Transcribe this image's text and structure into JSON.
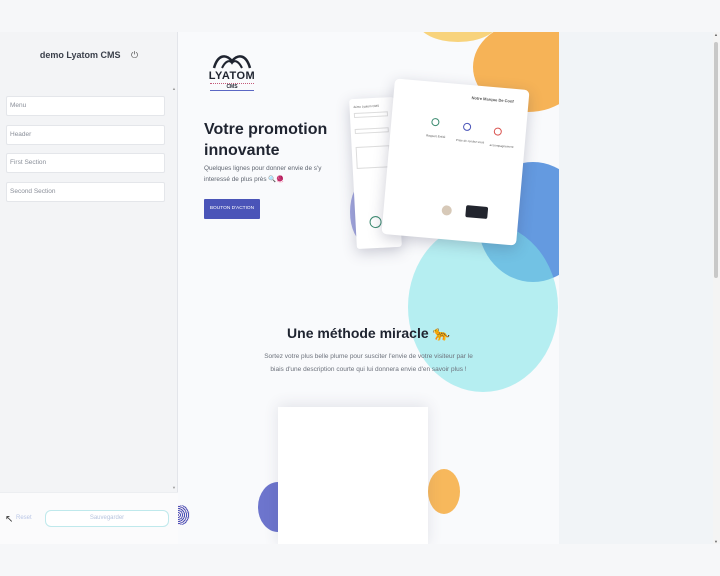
{
  "sidebar": {
    "title": "demo Lyatom CMS",
    "power_icon": "power-icon",
    "items": [
      {
        "label": "Menu"
      },
      {
        "label": "Header"
      },
      {
        "label": "First Section"
      },
      {
        "label": "Second Section"
      }
    ],
    "reset_label": "Reset",
    "save_label": "Sauvegarder"
  },
  "preview": {
    "logo": {
      "name": "LYATOM",
      "sub": "CMS"
    },
    "hero": {
      "title": "Votre promotion innovante",
      "text": "Quelques lignes pour donner envie de s'y interessé de plus près 🔍🧶",
      "button": "BOUTON D'ACTION"
    },
    "mockup": {
      "heading": "Notre Marque De Conf",
      "sidebar_title": "démo Lyatom CMS",
      "col1": "Rapport Entité",
      "col2": "Prise de rendez-vous",
      "col3": "accompagnement"
    },
    "method": {
      "title": "Une méthode miracle 🐆",
      "text": "Sortez votre plus belle plume pour susciter l'envie de votre visiteur par le biais d'une description courte qui lui donnera envie d'en savoir plus !"
    }
  },
  "colors": {
    "accent": "#4a54b8",
    "orange": "#f5a623",
    "blue": "#5aa9e6",
    "teal": "#3fd6d6"
  }
}
